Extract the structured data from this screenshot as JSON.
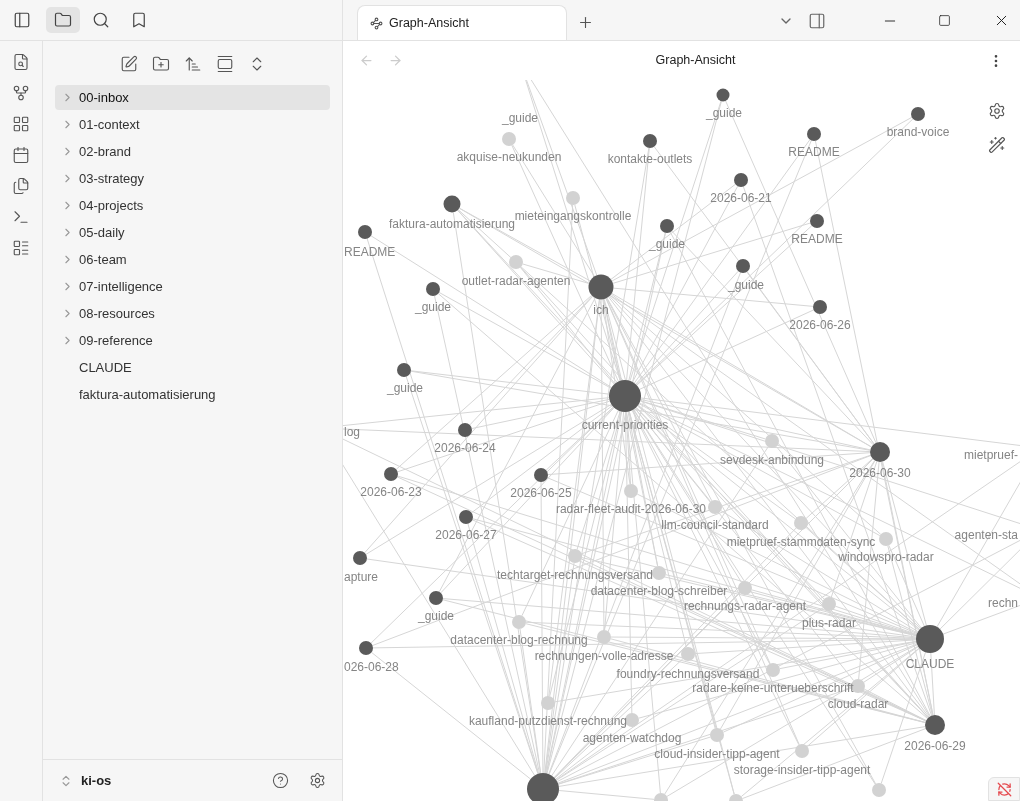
{
  "sidebar_tabs": [
    {
      "kind": "files",
      "selected": true
    },
    {
      "kind": "search",
      "selected": false
    },
    {
      "kind": "bookmarks",
      "selected": false
    }
  ],
  "tabs": [
    {
      "label": "Graph-Ansicht",
      "selected": true
    }
  ],
  "file_tree": [
    {
      "label": "00-inbox",
      "kind": "folder",
      "selected": true
    },
    {
      "label": "01-context",
      "kind": "folder",
      "selected": false
    },
    {
      "label": "02-brand",
      "kind": "folder",
      "selected": false
    },
    {
      "label": "03-strategy",
      "kind": "folder",
      "selected": false
    },
    {
      "label": "04-projects",
      "kind": "folder",
      "selected": false
    },
    {
      "label": "05-daily",
      "kind": "folder",
      "selected": false
    },
    {
      "label": "06-team",
      "kind": "folder",
      "selected": false
    },
    {
      "label": "07-intelligence",
      "kind": "folder",
      "selected": false
    },
    {
      "label": "08-resources",
      "kind": "folder",
      "selected": false
    },
    {
      "label": "09-reference",
      "kind": "folder",
      "selected": false
    },
    {
      "label": "CLAUDE",
      "kind": "file",
      "selected": false
    },
    {
      "label": "faktura-automatisierung",
      "kind": "file",
      "selected": false
    }
  ],
  "vault": {
    "name": "ki-os"
  },
  "view": {
    "title": "Graph-Ansicht"
  },
  "graph": {
    "nodes": [
      {
        "label": "_guide",
        "kind": "note"
      },
      {
        "label": "_guide",
        "kind": "note"
      },
      {
        "label": "brand-voice",
        "kind": "note"
      },
      {
        "label": "akquise-neukunden",
        "kind": "unresolved"
      },
      {
        "label": "kontakte-outlets",
        "kind": "note"
      },
      {
        "label": "README",
        "kind": "note"
      },
      {
        "label": "2026-06-21",
        "kind": "note"
      },
      {
        "label": "mieteingangskontrolle",
        "kind": "unresolved"
      },
      {
        "label": "faktura-automatisierung",
        "kind": "note"
      },
      {
        "label": "_guide",
        "kind": "note"
      },
      {
        "label": "README",
        "kind": "note"
      },
      {
        "label": "README",
        "kind": "note"
      },
      {
        "label": "outlet-radar-agenten",
        "kind": "unresolved"
      },
      {
        "label": "_guide",
        "kind": "note"
      },
      {
        "label": "_guide",
        "kind": "note"
      },
      {
        "label": "ich",
        "kind": "note"
      },
      {
        "label": "2026-06-26",
        "kind": "note"
      },
      {
        "label": "_guide",
        "kind": "note"
      },
      {
        "label": "current-priorities",
        "kind": "note"
      },
      {
        "label": "log",
        "kind": "note"
      },
      {
        "label": "2026-06-24",
        "kind": "note"
      },
      {
        "label": "sevdesk-anbindung",
        "kind": "unresolved"
      },
      {
        "label": "mietpruef-",
        "kind": "note"
      },
      {
        "label": "2026-06-30",
        "kind": "note"
      },
      {
        "label": "2026-06-23",
        "kind": "note"
      },
      {
        "label": "2026-06-25",
        "kind": "note"
      },
      {
        "label": "radar-fleet-audit-2026-06-30",
        "kind": "unresolved"
      },
      {
        "label": "llm-council-standard",
        "kind": "unresolved"
      },
      {
        "label": "2026-06-27",
        "kind": "note"
      },
      {
        "label": "agenten-sta",
        "kind": "note"
      },
      {
        "label": "mietpruef-stammdaten-sync",
        "kind": "unresolved"
      },
      {
        "label": "windowspro-radar",
        "kind": "unresolved"
      },
      {
        "label": "apture",
        "kind": "note"
      },
      {
        "label": "techtarget-rechnungsversand",
        "kind": "unresolved"
      },
      {
        "label": "datacenter-blog-schreiber",
        "kind": "unresolved"
      },
      {
        "label": "rechnungs-radar-agent",
        "kind": "unresolved"
      },
      {
        "label": "rechn",
        "kind": "note"
      },
      {
        "label": "_guide",
        "kind": "note"
      },
      {
        "label": "plus-radar",
        "kind": "unresolved"
      },
      {
        "label": "datacenter-blog-rechnung",
        "kind": "unresolved"
      },
      {
        "label": "rechnungen-volle-adresse",
        "kind": "unresolved"
      },
      {
        "label": "026-06-28",
        "kind": "note"
      },
      {
        "label": "CLAUDE",
        "kind": "note"
      },
      {
        "label": "foundry-rechnungsversand",
        "kind": "unresolved"
      },
      {
        "label": "radare-keine-unterueberschrift",
        "kind": "unresolved"
      },
      {
        "label": "cloud-radar",
        "kind": "unresolved"
      },
      {
        "label": "kaufland-putzdienst-rechnung",
        "kind": "unresolved"
      },
      {
        "label": "agenten-watchdog",
        "kind": "unresolved"
      },
      {
        "label": "2026-06-29",
        "kind": "note"
      },
      {
        "label": "cloud-insider-tipp-agent",
        "kind": "unresolved"
      },
      {
        "label": "storage-insider-tipp-agent",
        "kind": "unresolved"
      },
      {
        "kind": "note"
      },
      {
        "kind": "unresolved"
      },
      {
        "kind": "unresolved"
      },
      {
        "kind": "unresolved"
      }
    ]
  }
}
